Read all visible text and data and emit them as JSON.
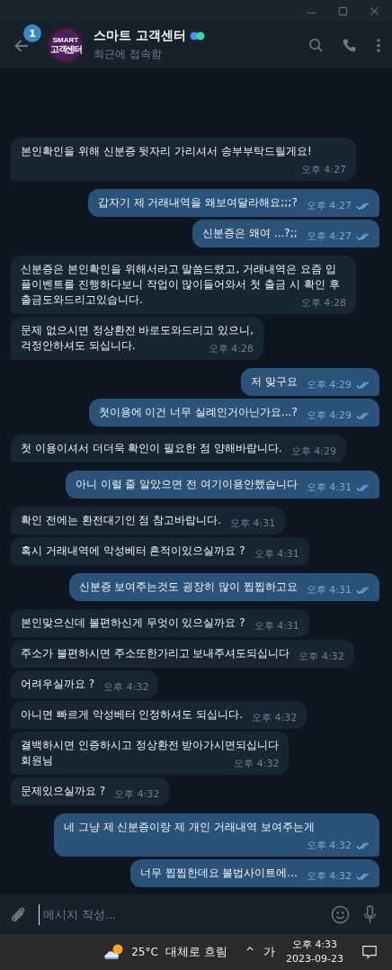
{
  "header": {
    "unread_badge": "1",
    "avatar": {
      "line_1": "SMART",
      "line_2": "고객센터"
    },
    "title": "스마트 고객센터",
    "status": "최근에 접속함"
  },
  "messages": [
    {
      "kind": "in",
      "text": "본인확인을 위해 신분증 뒷자리 가리셔서 송부부탁드릴게요!",
      "time": "오후 4:27"
    },
    {
      "kind": "out",
      "text": "갑자기 제 거래내역을 왜보여달라해요;;;?",
      "time": "오후 4:27",
      "read": true
    },
    {
      "kind": "out",
      "text": "신분증은 왜여 ...?;;",
      "time": "오후 4:27",
      "read": true
    },
    {
      "kind": "in",
      "text": "신분증은 본인확인을 위해서라고 말씀드렸고, 거래내역은 요즘 입플이벤트를 진행하다보니 작업이 많이들어와서 첫 출금 시 확인 후 출금도와드리고있습니다.",
      "time": "오후 4:28"
    },
    {
      "kind": "in",
      "text": "문제 없으시면 정상환전 바로도와드리고 있으니,\n걱정안하셔도 되십니다.",
      "time": "오후 4:28"
    },
    {
      "kind": "out",
      "text": "저 맞구요",
      "time": "오후 4:29",
      "read": true
    },
    {
      "kind": "out",
      "text": "첫이용에 이건 너무 실례인거아닌가요...?",
      "time": "오후 4:29",
      "read": true
    },
    {
      "kind": "in",
      "text": "첫 이용이셔서 더더욱 확인이 필요한 점 양해바랍니다.",
      "time": "오후 4:29"
    },
    {
      "kind": "out",
      "text": "아니 이럴 줄 알았으면 전 여기이용안했습니다",
      "time": "오후 4:31",
      "read": true
    },
    {
      "kind": "in",
      "text": "확인 전에는 환전대기인 점 참고바랍니다.",
      "time": "오후 4:31"
    },
    {
      "kind": "in",
      "text": "혹시 거래내역에 악성베터 흔적이있으실까요 ?",
      "time": "오후 4:31"
    },
    {
      "kind": "out",
      "text": "신분증 보여주는것도 굉장히 많이 찝찝하고요",
      "time": "오후 4:31",
      "read": true
    },
    {
      "kind": "in",
      "text": "본인맞으신데 불편하신게 무엇이 있으실까요 ?",
      "time": "오후 4:31"
    },
    {
      "kind": "in",
      "text": "주소가 불편하시면 주소또한가리고 보내주셔도되십니다",
      "time": "오후 4:32"
    },
    {
      "kind": "in",
      "text": "어려우실까요 ?",
      "time": "오후 4:32"
    },
    {
      "kind": "in",
      "text": "아니면 빠르게 악성베터 인정하셔도 되십니다.",
      "time": "오후 4:32"
    },
    {
      "kind": "in",
      "text": "결백하시면 인증하시고 정상환전 받아가시면되십니다\n회원님",
      "time": "오후 4:32"
    },
    {
      "kind": "in",
      "text": "문제있으실까요 ?",
      "time": "오후 4:32"
    },
    {
      "kind": "out",
      "text": "네 그냥 제 신분증이랑 제 개인 거래내역 보여주는게",
      "time": "오후 4:32",
      "read": true
    },
    {
      "kind": "out",
      "text": "너무 찝찝한데요 불법사이트에...",
      "time": "오후 4:32",
      "read": true
    }
  ],
  "composer": {
    "placeholder": "메시지 작성..."
  },
  "taskbar": {
    "temperature": "25°C",
    "weather": "대체로 흐림",
    "caret": "^",
    "input_mode": "가",
    "time": "오후 4:33",
    "date": "2023-09-23"
  }
}
